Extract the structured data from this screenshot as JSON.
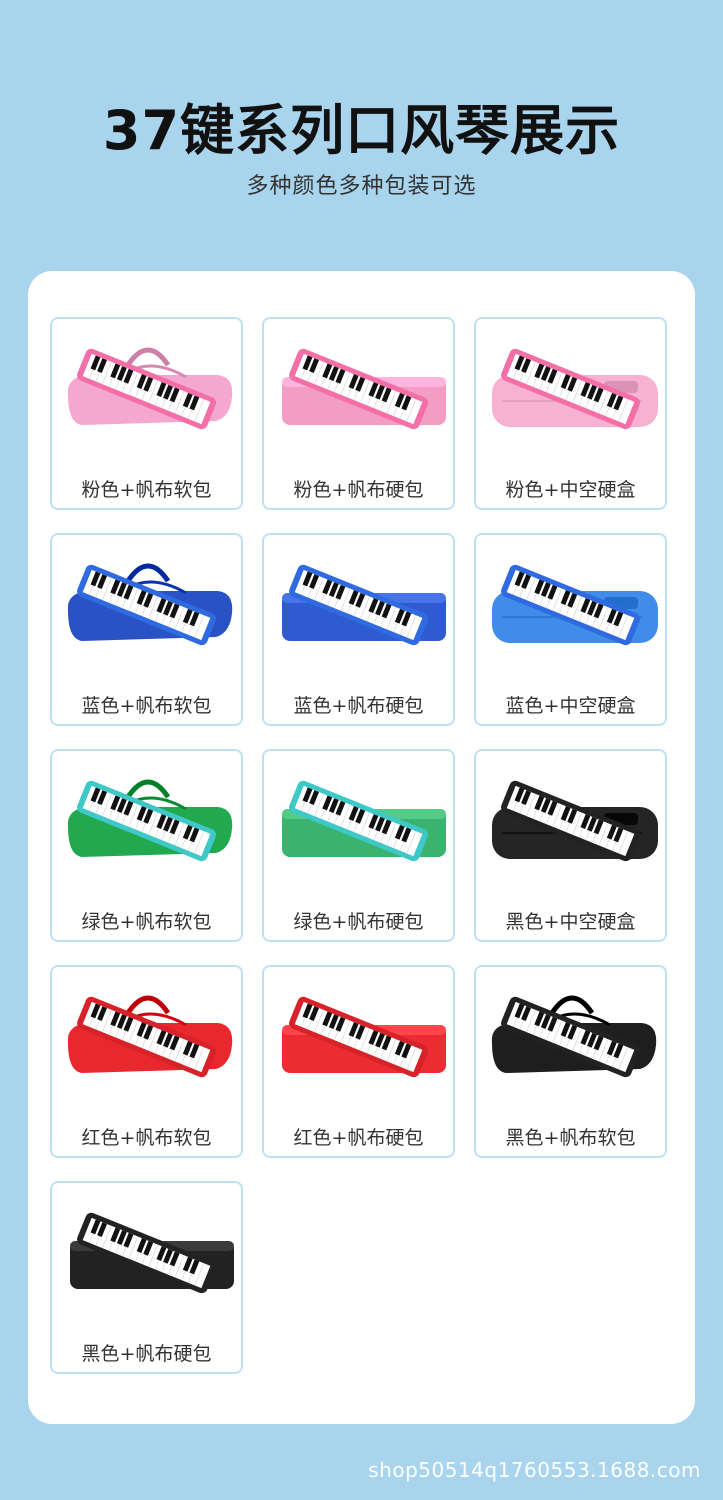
{
  "header": {
    "title": "37键系列口风琴展示",
    "subtitle": "多种颜色多种包装可选"
  },
  "products": [
    {
      "label": "粉色+帆布软包",
      "color": "#f08cc0",
      "case_color": "#f5a8cf",
      "keyboard_color": "#f46fa8",
      "case_type": "soft-bag-icon"
    },
    {
      "label": "粉色+帆布硬包",
      "color": "#f08cc0",
      "case_color": "#f39cc4",
      "keyboard_color": "#f46fa8",
      "case_type": "hard-bag-icon"
    },
    {
      "label": "粉色+中空硬盒",
      "color": "#f08cc0",
      "case_color": "#f7b2d2",
      "keyboard_color": "#f46fa8",
      "case_type": "hollow-box-icon"
    },
    {
      "label": "蓝色+帆布软包",
      "color": "#2e5fd1",
      "case_color": "#2a52c4",
      "keyboard_color": "#2f6ae0",
      "case_type": "soft-bag-icon"
    },
    {
      "label": "蓝色+帆布硬包",
      "color": "#2e5fd1",
      "case_color": "#2f5bd0",
      "keyboard_color": "#2f6ae0",
      "case_type": "hard-bag-icon"
    },
    {
      "label": "蓝色+中空硬盒",
      "color": "#3a86e8",
      "case_color": "#3f8de9",
      "keyboard_color": "#2f6ae0",
      "case_type": "hollow-box-icon"
    },
    {
      "label": "绿色+帆布软包",
      "color": "#1ea650",
      "case_color": "#22a84f",
      "keyboard_color": "#3ec8c8",
      "case_type": "soft-bag-icon"
    },
    {
      "label": "绿色+帆布硬包",
      "color": "#2fb46a",
      "case_color": "#39b36d",
      "keyboard_color": "#3ec8c8",
      "case_type": "hard-bag-icon"
    },
    {
      "label": "黑色+中空硬盒",
      "color": "#222222",
      "case_color": "#252525",
      "keyboard_color": "#222222",
      "case_type": "hollow-box-icon"
    },
    {
      "label": "红色+帆布软包",
      "color": "#e1262c",
      "case_color": "#e8282e",
      "keyboard_color": "#d8222a",
      "case_type": "soft-bag-icon"
    },
    {
      "label": "红色+帆布硬包",
      "color": "#e1262c",
      "case_color": "#ec2c33",
      "keyboard_color": "#d8222a",
      "case_type": "hard-bag-icon"
    },
    {
      "label": "黑色+帆布软包",
      "color": "#222222",
      "case_color": "#1e1e1e",
      "keyboard_color": "#222222",
      "case_type": "soft-bag-icon"
    },
    {
      "label": "黑色+帆布硬包",
      "color": "#222222",
      "case_color": "#222222",
      "keyboard_color": "#222222",
      "case_type": "hard-bag-icon"
    }
  ],
  "footer": {
    "watermark": "shop50514q1760553.1688.com"
  },
  "colors": {
    "background": "#a9d4ee",
    "panel": "#ffffff",
    "card_border": "#bfe0f2"
  }
}
